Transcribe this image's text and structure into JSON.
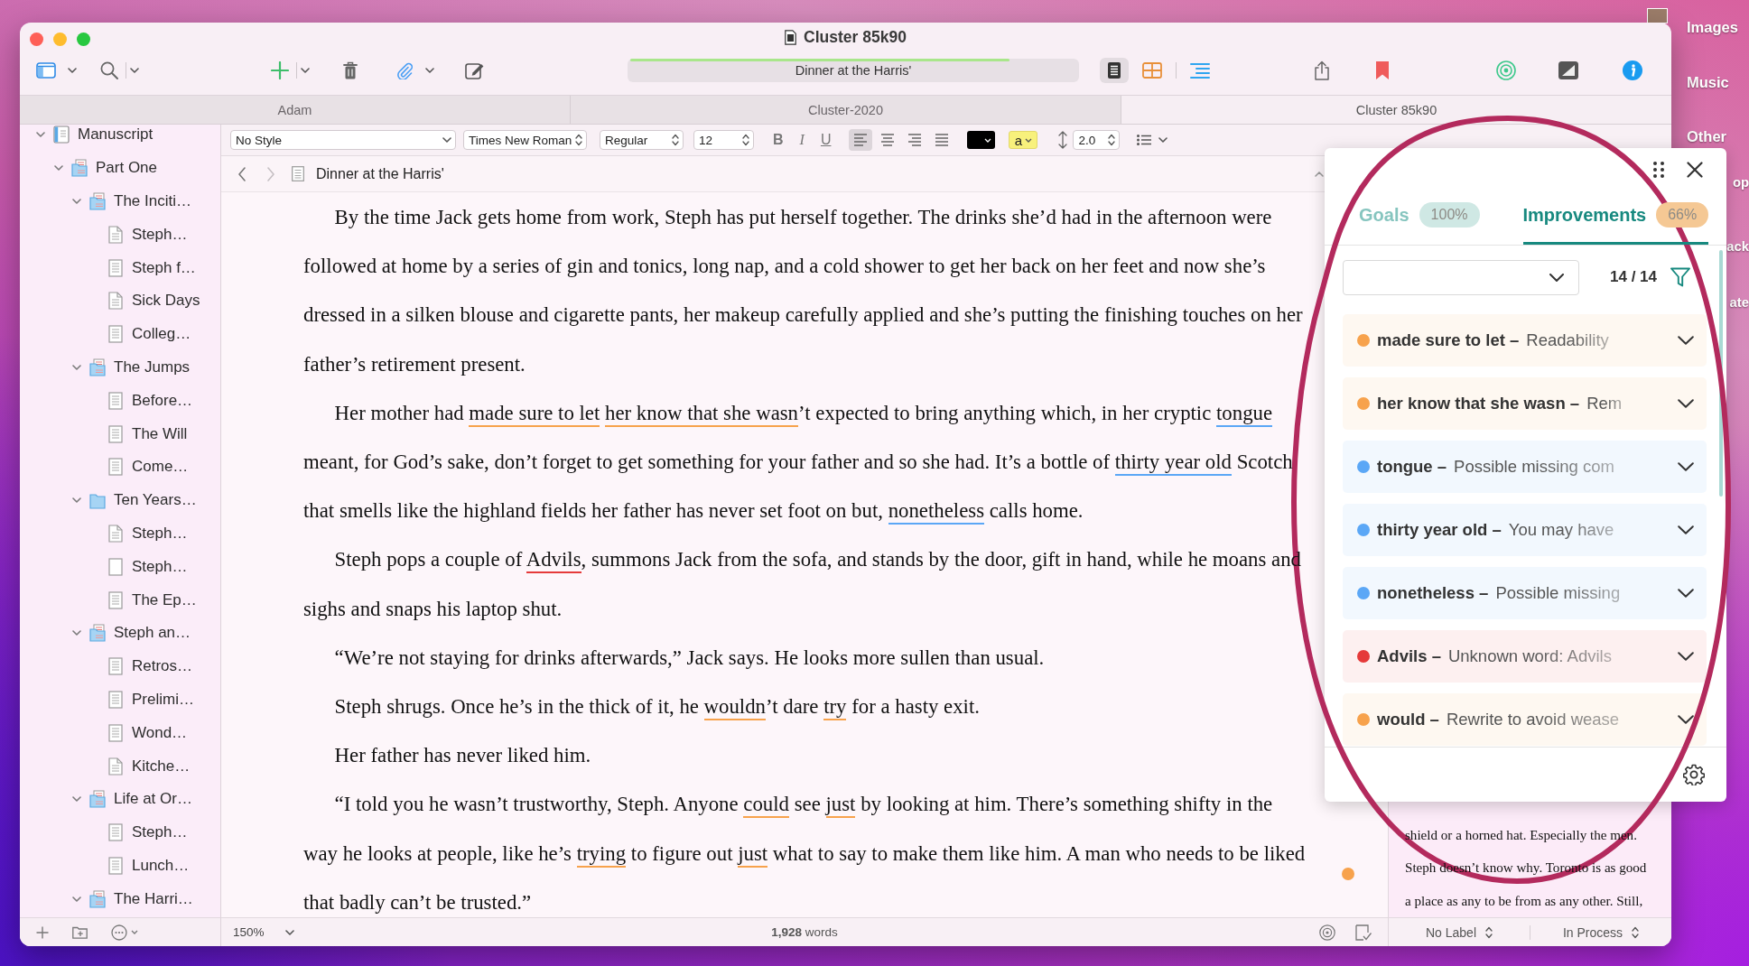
{
  "window": {
    "title": "Cluster 85k90"
  },
  "toolbar": {
    "document": {
      "title": "Dinner at the Harris'",
      "level": 0.85
    },
    "views": [
      {
        "kind": "document",
        "selected": true
      },
      {
        "kind": "corkboard",
        "selected": false
      },
      {
        "kind": "outline",
        "selected": false
      }
    ]
  },
  "tabs": [
    {
      "label": "Adam",
      "selected": false
    },
    {
      "label": "Cluster-2020",
      "selected": false
    },
    {
      "label": "Cluster 85k90",
      "selected": true
    }
  ],
  "binder": {
    "items": [
      {
        "label": "Manuscript",
        "kind": "manuscript",
        "expanded": true,
        "children": [
          {
            "label": "Part One",
            "kind": "folder-docs",
            "expanded": true,
            "children": [
              {
                "label": "The Inciti…",
                "kind": "folder-docs",
                "expanded": true,
                "children": [
                  {
                    "label": "Steph…",
                    "kind": "doc-corner"
                  },
                  {
                    "label": "Steph f…",
                    "kind": "doc-lines"
                  },
                  {
                    "label": "Sick Days",
                    "kind": "doc-corner"
                  },
                  {
                    "label": "Colleg…",
                    "kind": "doc-lines"
                  }
                ]
              },
              {
                "label": "The Jumps",
                "kind": "folder-docs",
                "expanded": true,
                "children": [
                  {
                    "label": "Before…",
                    "kind": "doc-lines"
                  },
                  {
                    "label": "The Will",
                    "kind": "doc-lines"
                  },
                  {
                    "label": "Come…",
                    "kind": "doc-lines"
                  }
                ]
              },
              {
                "label": "Ten Years…",
                "kind": "folder",
                "expanded": true,
                "children": [
                  {
                    "label": "Steph…",
                    "kind": "doc-corner"
                  },
                  {
                    "label": "Steph…",
                    "kind": "doc-blank"
                  },
                  {
                    "label": "The Ep…",
                    "kind": "doc-lines"
                  }
                ]
              },
              {
                "label": "Steph an…",
                "kind": "folder-docs",
                "expanded": true,
                "children": [
                  {
                    "label": "Retros…",
                    "kind": "doc-lines"
                  },
                  {
                    "label": "Prelimi…",
                    "kind": "doc-lines"
                  },
                  {
                    "label": "Wond…",
                    "kind": "doc-lines"
                  },
                  {
                    "label": "Kitche…",
                    "kind": "doc-corner"
                  }
                ]
              },
              {
                "label": "Life at Or…",
                "kind": "folder-docs",
                "expanded": true,
                "children": [
                  {
                    "label": "Steph…",
                    "kind": "doc-lines"
                  },
                  {
                    "label": "Lunch…",
                    "kind": "doc-lines"
                  }
                ]
              },
              {
                "label": "The Harri…",
                "kind": "folder-docs",
                "expanded": true
              }
            ]
          }
        ]
      }
    ]
  },
  "format_bar": {
    "style": "No Style",
    "font": "Times New Roman",
    "weight": "Regular",
    "size": "12",
    "styles": [
      {
        "label": "B",
        "kind": "bold"
      },
      {
        "label": "I",
        "kind": "italic"
      },
      {
        "label": "U",
        "kind": "underline"
      }
    ],
    "alignments": [
      {
        "kind": "left",
        "selected": true
      },
      {
        "kind": "center",
        "selected": false
      },
      {
        "kind": "right",
        "selected": false
      },
      {
        "kind": "justify",
        "selected": false
      }
    ],
    "highlight": {
      "label": "a",
      "color": "#f8f17c"
    },
    "line_spacing": "2.0"
  },
  "editor": {
    "nav": [
      {
        "kind": "back",
        "disabled": false
      },
      {
        "kind": "forward",
        "disabled": true
      }
    ],
    "title": "Dinner at the Harris'",
    "paragraphs": [
      {
        "segments": [
          {
            "text": "By the time Jack gets home from work, Steph has put herself together. The drinks she’d had in the afternoon were followed at home by a series of gin and tonics, long nap, and a cold shower to get her back on her feet and now she’s dressed in a silken blouse and cigarette pants, her makeup carefully applied and she’s putting the finishing touches on her father’s retirement present."
          }
        ]
      },
      {
        "segments": [
          {
            "text": "Her mother had "
          },
          {
            "text": "made sure to let ",
            "color": "#f7a24c"
          },
          {
            "text": "her know that she wasn",
            "color": "#f7a24c"
          },
          {
            "text": "’t expected to bring anything which, in her cryptic "
          },
          {
            "text": "tongue",
            "color": "#5ba7f6"
          },
          {
            "text": " meant, for God’s sake, don’t forget to get something for your father and so she had. It’s a bottle of "
          },
          {
            "text": "thirty year old",
            "color": "#5ba7f6"
          },
          {
            "text": " Scotch that smells like the highland fields her father has never set foot on but, "
          },
          {
            "text": "nonetheless",
            "color": "#5ba7f6"
          },
          {
            "text": " calls home."
          }
        ]
      },
      {
        "segments": [
          {
            "text": "Steph pops a couple of "
          },
          {
            "text": "Advils",
            "color": "#e53a3a"
          },
          {
            "text": ", summons Jack from the sofa, and stands by the door, gift in hand, while he moans and sighs and snaps his laptop shut."
          }
        ]
      },
      {
        "segments": [
          {
            "text": "“We’re not staying for drinks afterwards,” Jack says. He looks more sullen than usual."
          }
        ]
      },
      {
        "segments": [
          {
            "text": "Steph shrugs. Once he’s in the thick of it, he "
          },
          {
            "text": "wouldn",
            "color": "#f7a24c"
          },
          {
            "text": "’t dare "
          },
          {
            "text": "try",
            "color": "#f7a24c"
          },
          {
            "text": " for a hasty exit."
          }
        ]
      },
      {
        "segments": [
          {
            "text": "Her father has never liked him."
          }
        ]
      },
      {
        "segments": [
          {
            "text": "“I told you he wasn’t trustworthy, Steph. Anyone "
          },
          {
            "text": "could",
            "color": "#f7a24c"
          },
          {
            "text": " see "
          },
          {
            "text": "just",
            "color": "#f7a24c"
          },
          {
            "text": " by looking at him. There’s something shifty in the way he looks at people, like he’s "
          },
          {
            "text": "trying",
            "color": "#f7a24c"
          },
          {
            "text": " to figure out "
          },
          {
            "text": "just",
            "color": "#f7a24c"
          },
          {
            "text": " what to say to make them like him. A man who needs to be liked that badly can’t be trusted.”"
          }
        ]
      }
    ],
    "zoom": "150%",
    "word_count": "**1,928** words"
  },
  "side_editor": {
    "text": "shield or a horned hat. Especially the men. Steph doesn’t know why. Toronto is as good a place as any to be from as any other. Still,",
    "label": "No Label",
    "status": "In Process"
  },
  "grammar_panel": {
    "tabs": [
      {
        "label": "Goals",
        "badge": "100%",
        "color": "#cfe8e4",
        "selected": false
      },
      {
        "label": "Improvements",
        "badge": "66%",
        "color": "#f5c894",
        "selected": true
      }
    ],
    "count": "14 / 14",
    "issues": [
      {
        "phrase": "made sure to let –",
        "description": "Readability",
        "color": "#f7a24c"
      },
      {
        "phrase": "her know that she wasn –",
        "description": "Rem",
        "color": "#f7a24c"
      },
      {
        "phrase": "tongue –",
        "description": "Possible missing com",
        "color": "#5ba7f6"
      },
      {
        "phrase": "thirty year old –",
        "description": "You may have",
        "color": "#5ba7f6"
      },
      {
        "phrase": "nonetheless –",
        "description": "Possible missing",
        "color": "#5ba7f6"
      },
      {
        "phrase": "Advils –",
        "description": "Unknown word: Advils",
        "color": "#e53a3a"
      },
      {
        "phrase": "would –",
        "description": "Rewrite to avoid wease",
        "color": "#f7a24c"
      }
    ]
  },
  "desktop": {
    "photo_label": "Images",
    "labels": [
      "Music",
      "Other"
    ],
    "covered_labels": [
      "op",
      "ack",
      "ate"
    ]
  }
}
